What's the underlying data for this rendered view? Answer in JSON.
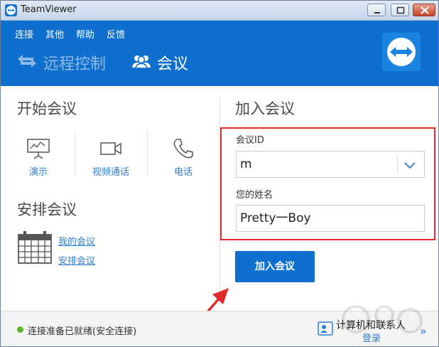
{
  "window": {
    "title": "TeamViewer"
  },
  "menu": {
    "items": [
      "连接",
      "其他",
      "帮助",
      "反馈"
    ]
  },
  "nav": {
    "remote_control": "远程控制",
    "meeting": "会议"
  },
  "start_meeting": {
    "title": "开始会议",
    "options": [
      {
        "label": "演示",
        "icon": "presentation-icon"
      },
      {
        "label": "视频通话",
        "icon": "video-camera-icon"
      },
      {
        "label": "电话",
        "icon": "phone-icon"
      }
    ]
  },
  "schedule_meeting": {
    "title": "安排会议",
    "links": [
      "我的会议",
      "安排会议"
    ]
  },
  "join_meeting": {
    "title": "加入会议",
    "meeting_id_label": "会议ID",
    "meeting_id_value": "m",
    "name_label": "您的姓名",
    "name_value": "Pretty一Boy",
    "join_button": "加入会议"
  },
  "footer": {
    "status": "连接准备已就绪(安全连接)",
    "contacts_title": "计算机和联系人",
    "contacts_login": "登录"
  },
  "colors": {
    "brand_blue": "#0e6fce",
    "link_blue": "#2f7dd1",
    "annotation_red": "#e02b2b",
    "status_green": "#5cb531"
  }
}
